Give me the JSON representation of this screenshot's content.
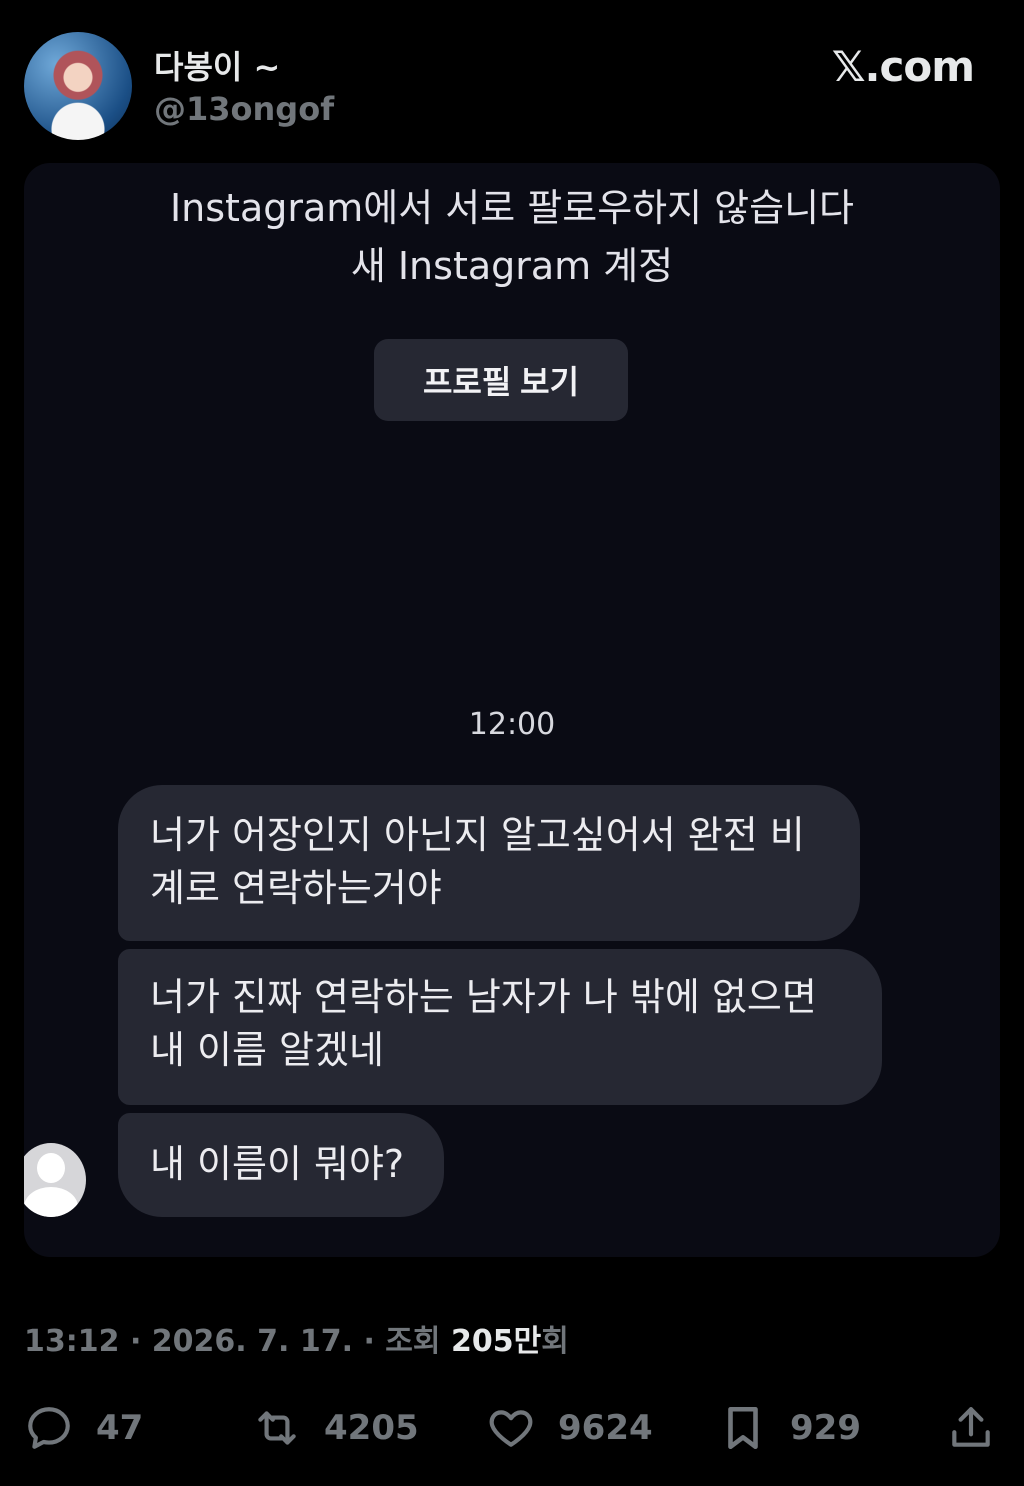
{
  "author": {
    "display_name": "다봉이 ~",
    "handle": "@13ongof"
  },
  "brand": "𝕏.com",
  "screenshot": {
    "notice_line1": "Instagram에서 서로 팔로우하지 않습니다",
    "notice_line2": "새 Instagram 계정",
    "profile_button": "프로필 보기",
    "time": "12:00",
    "messages": [
      "너가 어장인지 아닌지 알고싶어서 완전 비계로 연락하는거야",
      "너가 진짜 연락하는 남자가 나 밖에 없으면 내 이름 알겠네",
      "내 이름이 뭐야?"
    ]
  },
  "meta": {
    "time": "13:12",
    "date": "2026. 7. 17.",
    "views_label": "조회",
    "views_count": "205만",
    "views_unit": "회"
  },
  "actions": {
    "replies": "47",
    "reposts": "4205",
    "likes": "9624",
    "bookmarks": "929"
  },
  "icons": [
    "reply-icon",
    "repost-icon",
    "like-icon",
    "bookmark-icon",
    "share-icon"
  ]
}
